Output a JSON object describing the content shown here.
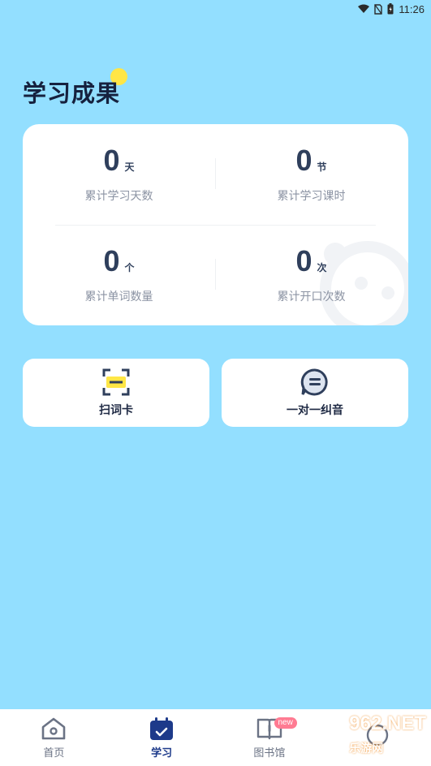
{
  "status": {
    "time": "11:26"
  },
  "page_title": "学习成果",
  "stats": [
    {
      "value": "0",
      "unit": "天",
      "label": "累计学习天数"
    },
    {
      "value": "0",
      "unit": "节",
      "label": "累计学习课时"
    },
    {
      "value": "0",
      "unit": "个",
      "label": "累计单词数量"
    },
    {
      "value": "0",
      "unit": "次",
      "label": "累计开口次数"
    }
  ],
  "tools": [
    {
      "label": "扫词卡",
      "icon": "scan-card-icon"
    },
    {
      "label": "一对一纠音",
      "icon": "chat-bubble-icon"
    }
  ],
  "tabs": [
    {
      "label": "首页",
      "icon": "home-icon",
      "active": false
    },
    {
      "label": "学习",
      "icon": "calendar-check-icon",
      "active": true
    },
    {
      "label": "图书馆",
      "icon": "book-icon",
      "badge": "new",
      "active": false
    },
    {
      "label": "",
      "icon": "profile-icon",
      "active": false
    }
  ],
  "watermark": {
    "text": "962.NET",
    "sub": "乐游网"
  },
  "colors": {
    "background": "#93dfff",
    "card": "#ffffff",
    "accent": "#1d3a8a",
    "title_dot": "#ffe646",
    "badge": "#ff7b92"
  }
}
